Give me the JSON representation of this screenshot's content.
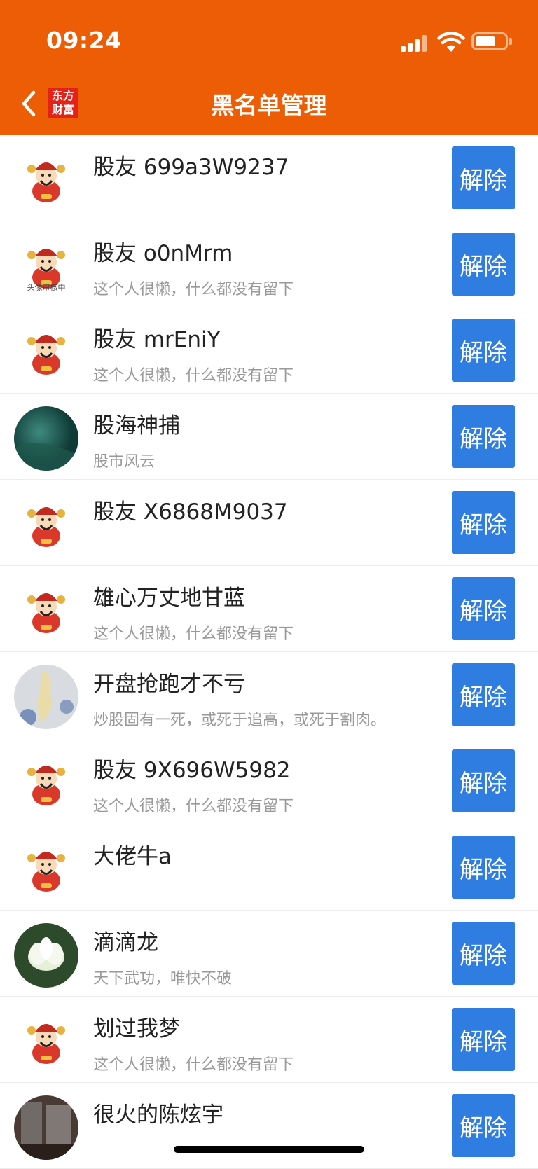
{
  "status_bar": {
    "time": "09:24"
  },
  "nav": {
    "logo_text_line1": "东方",
    "logo_text_line2": "财富",
    "title": "黑名单管理"
  },
  "colors": {
    "header": "#ec5d05",
    "button": "#2f7de1"
  },
  "blacklist": [
    {
      "name": "股友 699a3W9237",
      "signature": "",
      "avatar": "caishen-avatar",
      "button": "解除"
    },
    {
      "name": "股友 o0nMrm",
      "signature": "这个人很懒，什么都没有留下",
      "avatar": "caishen-avatar-review",
      "review_text": "头像审核中",
      "button": "解除"
    },
    {
      "name": "股友 mrEniY",
      "signature": "这个人很懒，什么都没有留下",
      "avatar": "caishen-avatar",
      "button": "解除"
    },
    {
      "name": "股海神捕",
      "signature": "股市风云",
      "avatar": "green-photo-avatar",
      "button": "解除"
    },
    {
      "name": "股友 X6868M9037",
      "signature": "",
      "avatar": "caishen-avatar",
      "button": "解除"
    },
    {
      "name": "雄心万丈地甘蓝",
      "signature": "这个人很懒，什么都没有留下",
      "avatar": "caishen-avatar",
      "button": "解除"
    },
    {
      "name": "开盘抢跑才不亏",
      "signature": "炒股固有一死，或死于追高，或死于割肉。",
      "avatar": "object-photo-avatar",
      "button": "解除"
    },
    {
      "name": "股友 9X696W5982",
      "signature": "这个人很懒，什么都没有留下",
      "avatar": "caishen-avatar",
      "button": "解除"
    },
    {
      "name": "大佬牛a",
      "signature": "",
      "avatar": "caishen-avatar",
      "button": "解除"
    },
    {
      "name": "滴滴龙",
      "signature": "天下武功，唯快不破",
      "avatar": "lotus-photo-avatar",
      "button": "解除"
    },
    {
      "name": "划过我梦",
      "signature": "这个人很懒，什么都没有留下",
      "avatar": "caishen-avatar",
      "button": "解除"
    },
    {
      "name": "很火的陈炫宇",
      "signature": "",
      "avatar": "room-photo-avatar",
      "button": "解除"
    }
  ]
}
